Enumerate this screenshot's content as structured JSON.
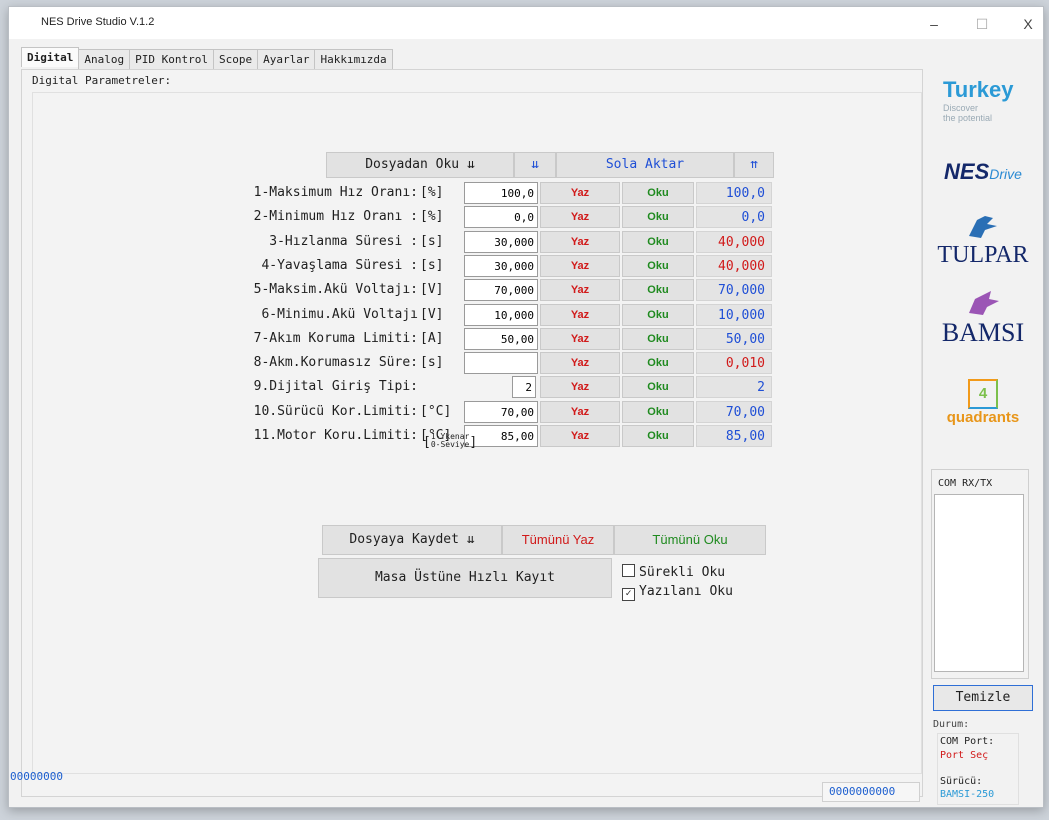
{
  "window": {
    "title": "NES Drive Studio V.1.2",
    "min": "–",
    "max": "☐",
    "close": "X"
  },
  "tabs": [
    "Digital",
    "Analog",
    "PID Kontrol",
    "Scope",
    "Ayarlar",
    "Hakkımızda"
  ],
  "panel_title": "Digital Parametreler:",
  "top_bar": {
    "read_file": "Dosyadan Oku ⇊",
    "arrows_down": "⇊",
    "sola_aktar": "Sola Aktar",
    "arrows_up": "⇈"
  },
  "rows": [
    {
      "label": "1-Maksimum Hız Oranı:",
      "unit": "[%]",
      "input": "100,0",
      "write": "Yaz",
      "read": "Oku",
      "value": "100,0",
      "value_color": "blue"
    },
    {
      "label": "2-Minimum Hız Oranı :",
      "unit": "[%]",
      "input": "0,0",
      "write": "Yaz",
      "read": "Oku",
      "value": "0,0",
      "value_color": "blue"
    },
    {
      "label": "3-Hızlanma Süresi   :",
      "unit": "[s]",
      "input": "30,000",
      "write": "Yaz",
      "read": "Oku",
      "value": "40,000",
      "value_color": "red"
    },
    {
      "label": "4-Yavaşlama Süresi  :",
      "unit": "[s]",
      "input": "30,000",
      "write": "Yaz",
      "read": "Oku",
      "value": "40,000",
      "value_color": "red"
    },
    {
      "label": "5-Maksim.Akü Voltajı:",
      "unit": "[V]",
      "input": "70,000",
      "write": "Yaz",
      "read": "Oku",
      "value": "70,000",
      "value_color": "blue"
    },
    {
      "label": "6-Minimu.Akü Voltajı",
      "unit": "[V]",
      "input": "10,000",
      "write": "Yaz",
      "read": "Oku",
      "value": "10,000",
      "value_color": "blue"
    },
    {
      "label": "7-Akım Koruma Limiti:",
      "unit": "[A]",
      "input": "50,00",
      "write": "Yaz",
      "read": "Oku",
      "value": "50,00",
      "value_color": "blue"
    },
    {
      "label": "8-Akm.Korumasız Süre:",
      "unit": "[s]",
      "input": "",
      "write": "Yaz",
      "read": "Oku",
      "value": "0,010",
      "value_color": "red"
    },
    {
      "label": "9.Dijital Giriş Tipi:",
      "unit": "",
      "input": "2",
      "write": "Yaz",
      "read": "Oku",
      "value": "2",
      "value_color": "blue"
    },
    {
      "label": "10.Sürücü Kor.Limiti:",
      "unit": "[°C]",
      "input": "70,00",
      "write": "Yaz",
      "read": "Oku",
      "value": "70,00",
      "value_color": "blue"
    },
    {
      "label": "11.Motor Koru.Limiti:",
      "unit": "[°C]",
      "input": "85,00",
      "write": "Yaz",
      "read": "Oku",
      "value": "85,00",
      "value_color": "blue"
    }
  ],
  "input_type_options": {
    "line1": "1-Ykenar",
    "line2": "0-Seviye"
  },
  "bottom_bar": {
    "save_file": "Dosyaya Kaydet ⇊",
    "write_all": "Tümünü Yaz",
    "read_all": "Tümünü Oku"
  },
  "quick_save": "Masa Üstüne Hızlı Kayıt",
  "checkboxes": [
    {
      "label": "Sürekli Oku",
      "checked": false
    },
    {
      "label": "Yazılanı Oku",
      "checked": true
    }
  ],
  "status_left": "00000000",
  "status_right": "0000000000",
  "sidebar": {
    "turkey": "Turkey",
    "turkey_sub1": "Discover",
    "turkey_sub2": "the potential",
    "nes": "NES",
    "nes_drive": "Drive",
    "tulpar": "TULPAR",
    "bamsi": "BAMSI",
    "quadrants_num": "4",
    "quadrants": "quadrants",
    "com_title": "COM RX/TX",
    "clear": "Temizle",
    "durum": "Durum:",
    "com_port": "COM Port:",
    "port_sec": "Port Seç",
    "surucu": "Sürücü:",
    "surucu_val": "BAMSI-250"
  }
}
